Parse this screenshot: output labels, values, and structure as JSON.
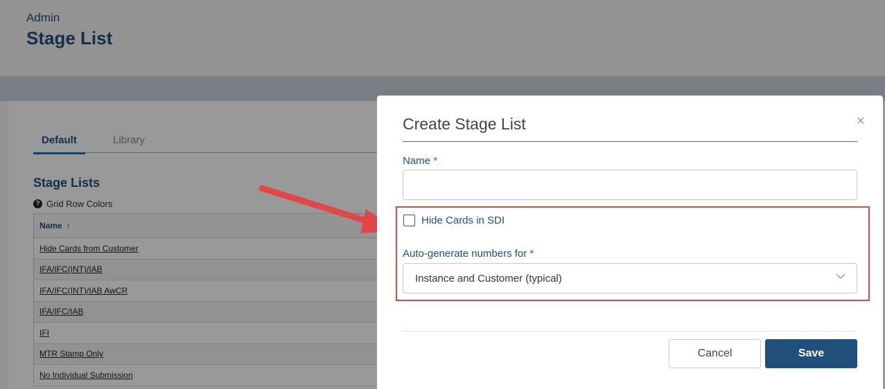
{
  "header": {
    "breadcrumb": "Admin",
    "title": "Stage List"
  },
  "tabs": [
    {
      "label": "Default"
    },
    {
      "label": "Library"
    }
  ],
  "section": {
    "title": "Stage Lists",
    "help_label": "Grid Row Colors"
  },
  "grid": {
    "column_header": "Name",
    "sort_indicator": "↑",
    "rows": [
      "Hide Cards from Customer",
      "IFA/IFC(INT)/IAB",
      "IFA/IFC(INT)/IAB AwCR",
      "IFA/IFC/IAB",
      "IFI",
      "MTR Stamp Only",
      "No Individual Submission"
    ]
  },
  "modal": {
    "title": "Create Stage List",
    "close_glyph": "×",
    "name_label": "Name",
    "name_value": "",
    "required_mark": "*",
    "hide_cards_label": "Hide Cards in SDI",
    "hide_cards_checked": false,
    "autogen_label": "Auto-generate numbers for",
    "autogen_value": "Instance and Customer (typical)",
    "cancel_label": "Cancel",
    "save_label": "Save"
  },
  "colors": {
    "accent": "#1f4f7a",
    "highlight": "#e04848",
    "arrow": "#e04848"
  }
}
